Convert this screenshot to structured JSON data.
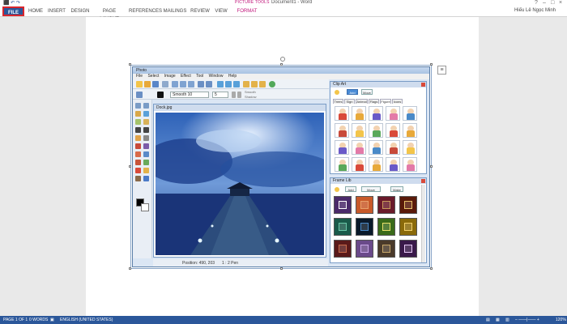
{
  "word": {
    "title": "Document1 - Word",
    "context_tab_group": "PICTURE TOOLS",
    "user_name": "Hiếu Lê Ngọc Minh",
    "tabs": [
      "FILE",
      "HOME",
      "INSERT",
      "DESIGN",
      "PAGE LAYOUT",
      "REFERENCES",
      "MAILINGS",
      "REVIEW",
      "VIEW",
      "FORMAT"
    ],
    "status": {
      "page": "PAGE 1 OF 1",
      "words": "0 WORDS",
      "language": "ENGLISH (UNITED STATES)",
      "zoom": "120%"
    }
  },
  "app": {
    "title": "Photo",
    "menu": [
      "File",
      "Select",
      "Image",
      "Effect",
      "Tool",
      "Window",
      "Help"
    ],
    "brush": "Smooth 10",
    "brush_size": "5",
    "check_smooth": "Smooth",
    "check_shadow": "Shadow",
    "image_title": "Dock.jpg",
    "status_position": "Position: 490, 203",
    "status_zoom": "1 : 2 Pen"
  },
  "clipart_panel": {
    "title": "Clip Art",
    "buttons": [
      "Add",
      "Move"
    ],
    "subtabs": [
      "Trees",
      "Sign",
      "Animal",
      "Flags",
      "Figure",
      "Icons"
    ]
  },
  "frame_panel": {
    "title": "Frame Lib",
    "buttons": [
      "Add",
      "Move",
      "Make"
    ]
  },
  "colors": {
    "word_blue": "#2b579a",
    "highlight_red": "#d8262d",
    "format_pink": "#c0147a"
  }
}
